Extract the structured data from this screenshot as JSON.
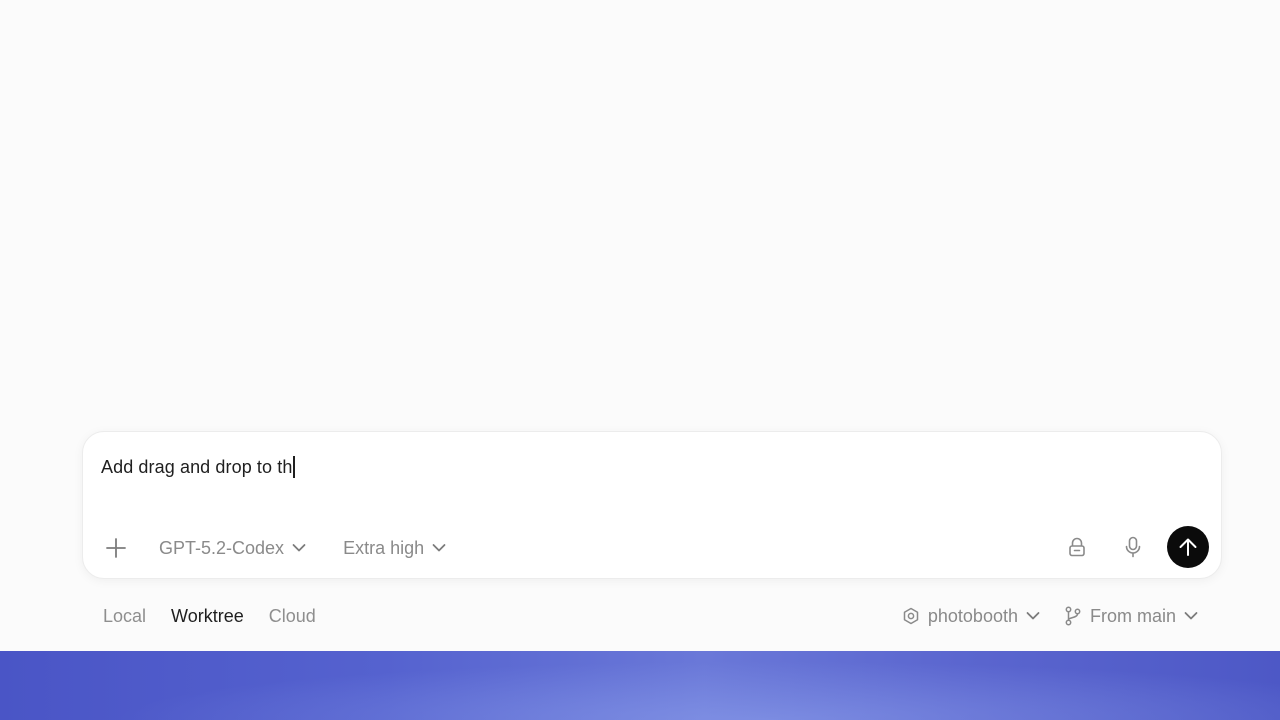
{
  "composer": {
    "input_value": "Add drag and drop to th",
    "model_label": "GPT-5.2-Codex",
    "reasoning_label": "Extra high"
  },
  "modes": [
    {
      "label": "Local",
      "active": false
    },
    {
      "label": "Worktree",
      "active": true
    },
    {
      "label": "Cloud",
      "active": false
    }
  ],
  "context": {
    "project_label": "photobooth",
    "branch_label": "From main"
  },
  "icons": {
    "attach": "plus-icon",
    "lock": "lock-icon",
    "mic": "microphone-icon",
    "send": "arrow-up-icon",
    "project": "gear-icon",
    "branch": "git-branch-icon"
  },
  "colors": {
    "send_button": "#0b0b0b",
    "backdrop": "#5562cf"
  }
}
